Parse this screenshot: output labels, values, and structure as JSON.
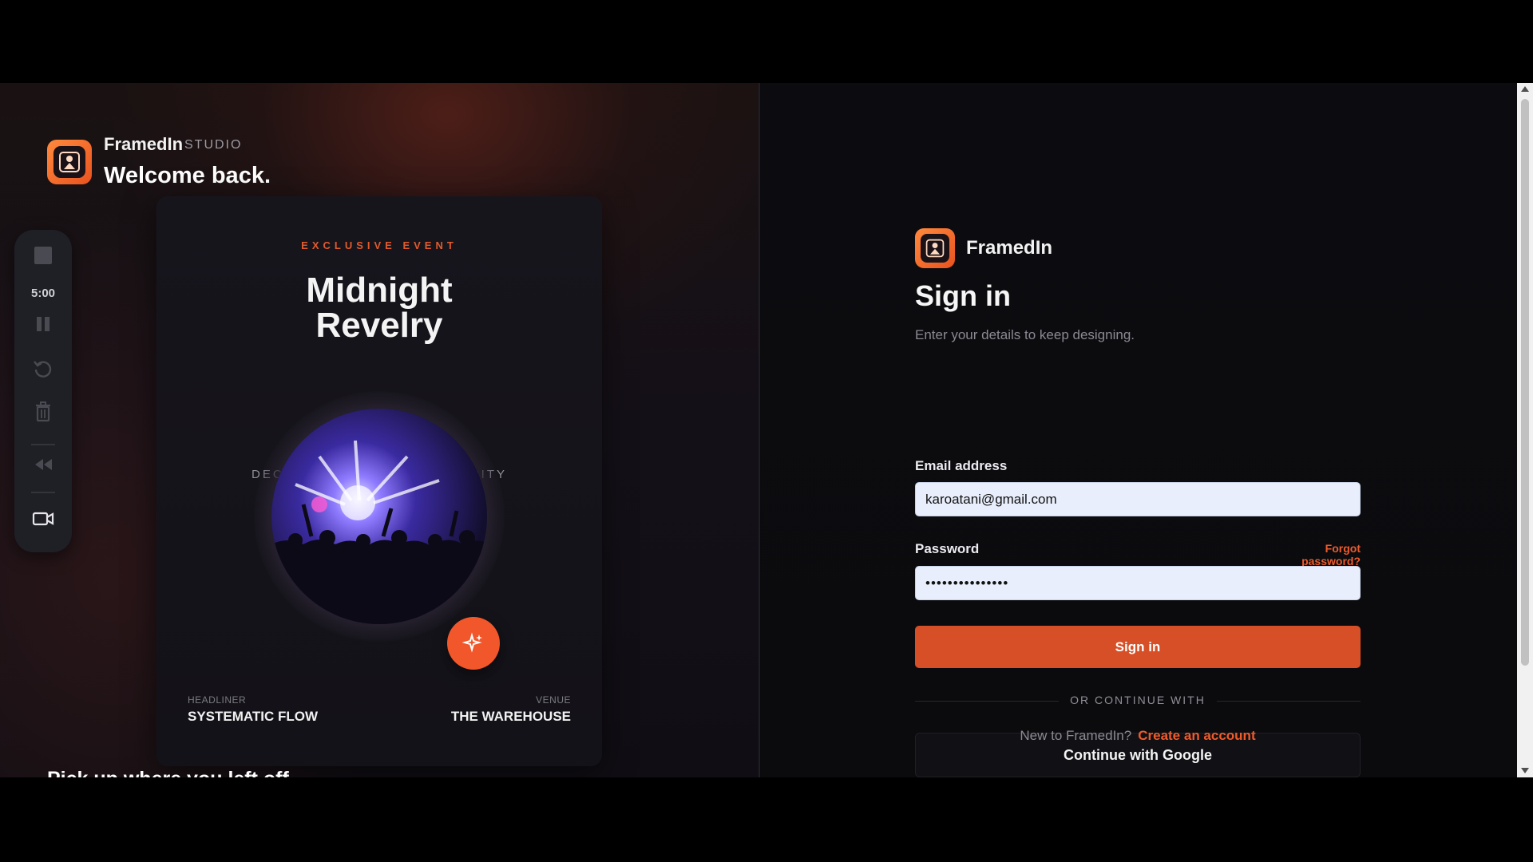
{
  "left": {
    "brand": {
      "name": "FramedIn",
      "tag": "STUDIO"
    },
    "welcome": "Welcome back.",
    "toolbar": {
      "timer": "5:00",
      "icons": [
        "stop-icon",
        "pause-icon",
        "restart-icon",
        "trash-icon",
        "rewind-icon",
        "camera-icon"
      ]
    },
    "card": {
      "eyebrow": "EXCLUSIVE EVENT",
      "title_line1": "Midnight",
      "title_line2": "Revelry",
      "meta": "DECEMBER 24 · NEW YORK CITY",
      "headliner_label": "HEADLINER",
      "headliner": "SYSTEMATIC FLOW",
      "venue_label": "VENUE",
      "venue": "THE WAREHOUSE"
    },
    "pickup": "Pick up where you left off"
  },
  "right": {
    "brand": "FramedIn",
    "title": "Sign in",
    "subtitle": "Enter your details to keep designing.",
    "email_label": "Email address",
    "email_value": "karoatani@gmail.com",
    "password_label": "Password",
    "password_value": "•••••••••••••••",
    "forgot": "Forgot password?",
    "signin": "Sign in",
    "or": "OR CONTINUE WITH",
    "google": "Continue with Google",
    "new_q": "New to FramedIn?",
    "create": "Create an account"
  },
  "colors": {
    "accent": "#ee5b2b",
    "button": "#d64f26",
    "background": "#0b0b0f"
  }
}
